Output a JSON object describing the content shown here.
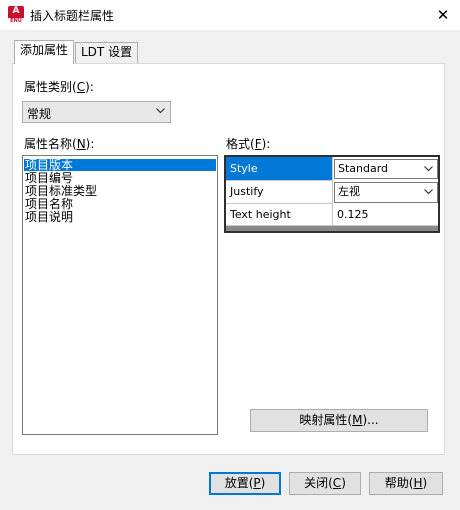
{
  "window": {
    "title": "插入标题栏属性",
    "app_icon_letter": "A",
    "app_icon_sub": "ENU",
    "close_glyph": "✕"
  },
  "tabs": [
    {
      "label": "添加属性",
      "active": true
    },
    {
      "label": "LDT 设置",
      "active": false
    }
  ],
  "category": {
    "label_pre": "属性类别(",
    "mnemonic": "C",
    "label_post": "):",
    "value": "常规"
  },
  "names": {
    "label_pre": "属性名称(",
    "mnemonic": "N",
    "label_post": "):",
    "items": [
      "项目版本",
      "项目编号",
      "项目标准类型",
      "项目名称",
      "项目说明"
    ],
    "selected_index": 0
  },
  "format": {
    "label_pre": "格式(",
    "mnemonic": "F",
    "label_post": "):",
    "rows": [
      {
        "name": "Style",
        "value": "Standard"
      },
      {
        "name": "Justify",
        "value": "左视"
      },
      {
        "name": "Text height",
        "value": "0.125"
      }
    ]
  },
  "map_button": {
    "pre": "映射属性(",
    "mnemonic": "M",
    "post": ")..."
  },
  "buttons": {
    "place": {
      "pre": "放置(",
      "mnemonic": "P",
      "post": ")"
    },
    "close": {
      "pre": "关闭(",
      "mnemonic": "C",
      "post": ")"
    },
    "help": {
      "pre": "帮助(",
      "mnemonic": "H",
      "post": ")"
    }
  },
  "colors": {
    "selection": "#0078d7",
    "icon_red": "#c8102e"
  }
}
